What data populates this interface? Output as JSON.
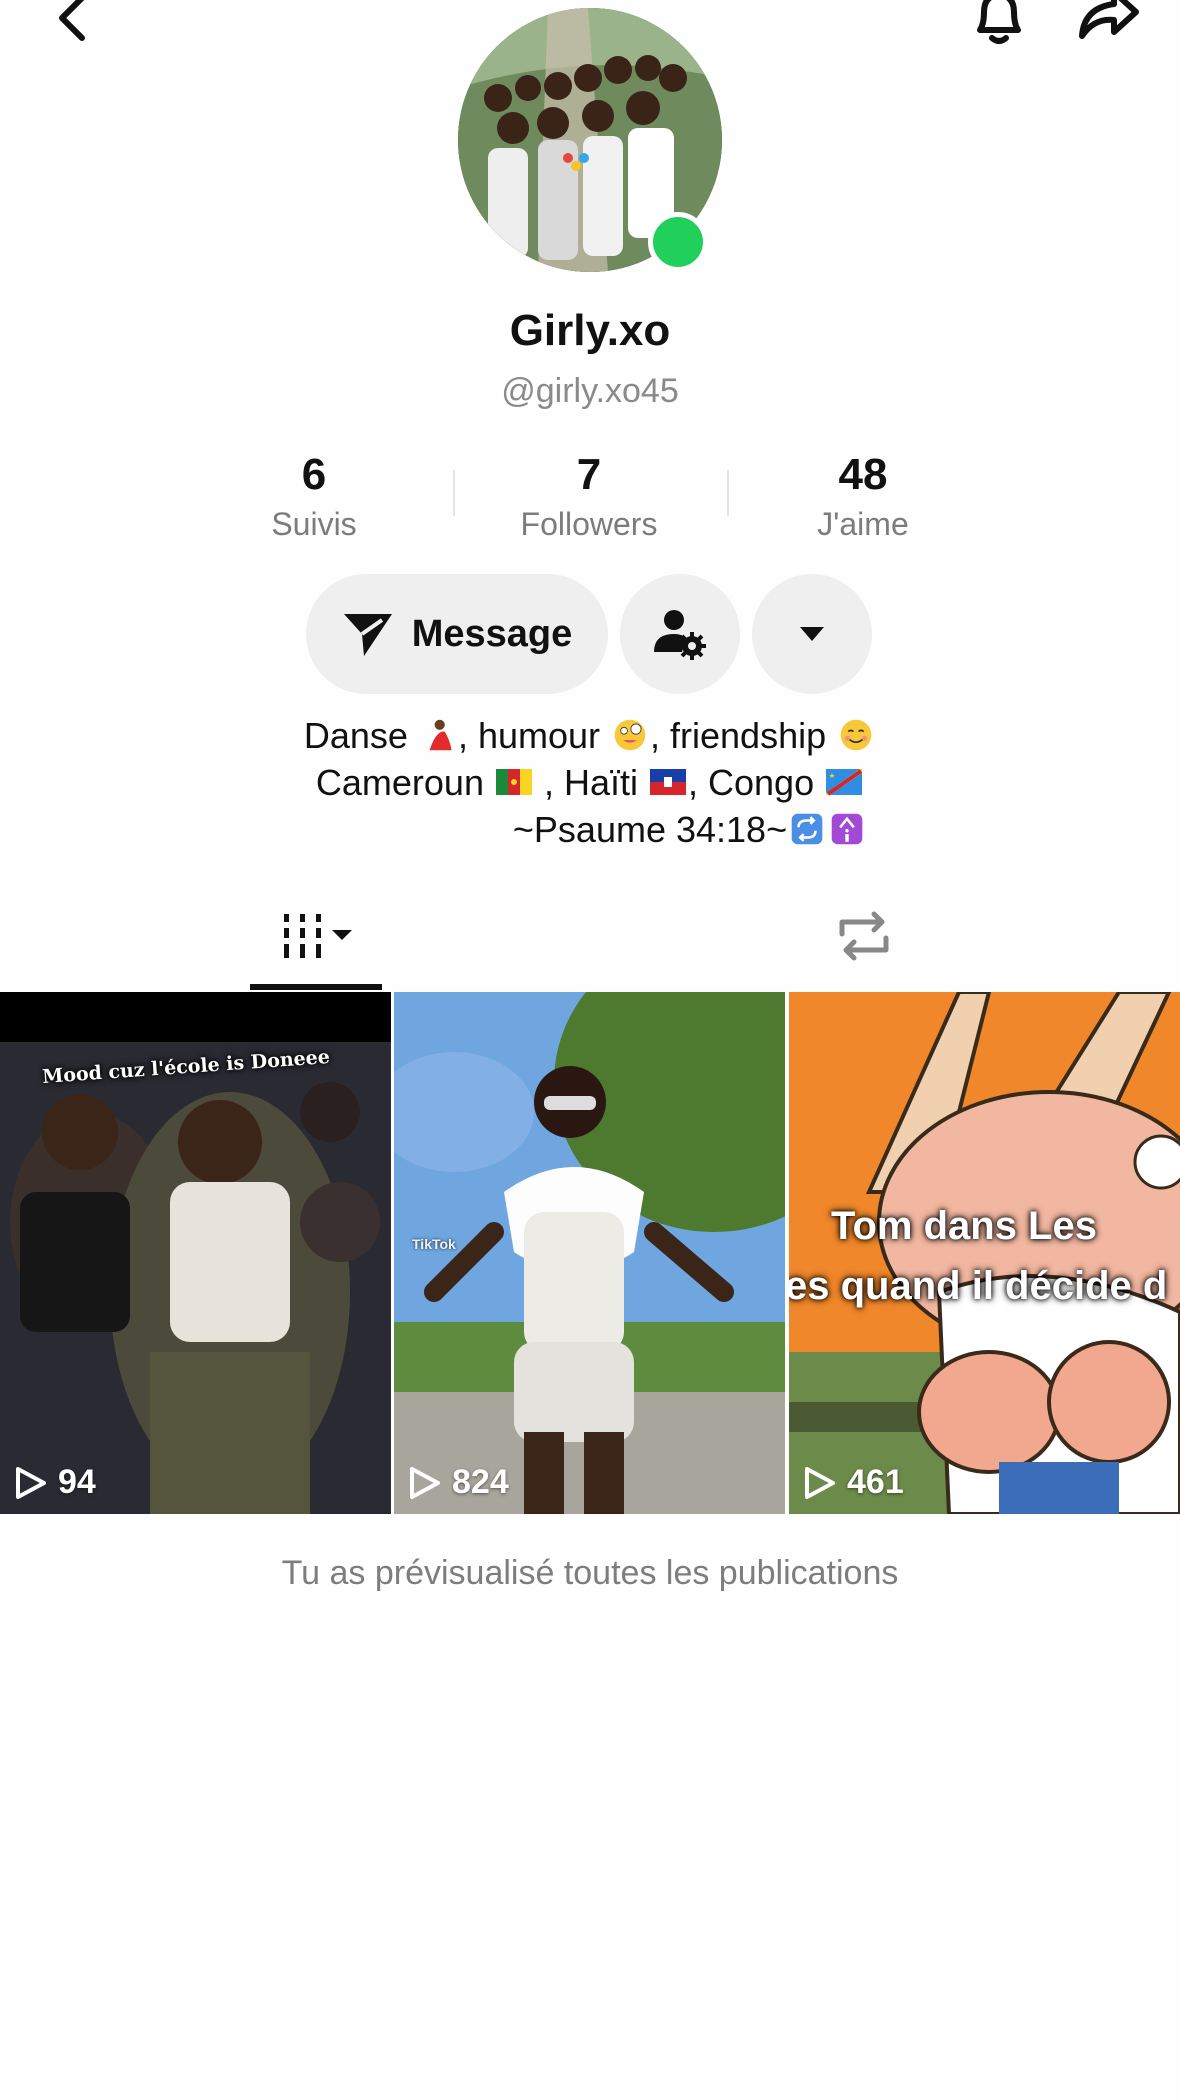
{
  "profile": {
    "display_name": "Girly.xo",
    "handle": "@girly.xo45",
    "online": true
  },
  "stats": [
    {
      "value": "6",
      "label": "Suivis"
    },
    {
      "value": "7",
      "label": "Followers"
    },
    {
      "value": "48",
      "label": "J'aime"
    }
  ],
  "actions": {
    "message_label": "Message"
  },
  "bio": {
    "line1_a": "Danse ",
    "line1_b": ", humour ",
    "line1_c": ", friendship ",
    "line2_a": "Cameroun ",
    "line2_b": " , Haïti ",
    "line2_c": ", Congo ",
    "line3": "~Psaume 34:18~"
  },
  "videos": [
    {
      "views": "94",
      "caption": "Mood cuz l'école is Doneee"
    },
    {
      "views": "824",
      "caption": "TikTok"
    },
    {
      "views": "461",
      "caption_line1": "Tom dans Les",
      "caption_line2": "es quand il décide d"
    }
  ],
  "end_note": "Tu as prévisualisé toutes les publications",
  "colors": {
    "online_dot": "#20d05a",
    "button_bg": "#efefef",
    "muted_text": "#7d7d7d"
  },
  "icons": [
    "back-icon",
    "bell-icon",
    "share-icon",
    "send-icon",
    "person-settings-icon",
    "dropdown-icon",
    "videos-grid-icon",
    "repost-icon",
    "play-icon"
  ]
}
